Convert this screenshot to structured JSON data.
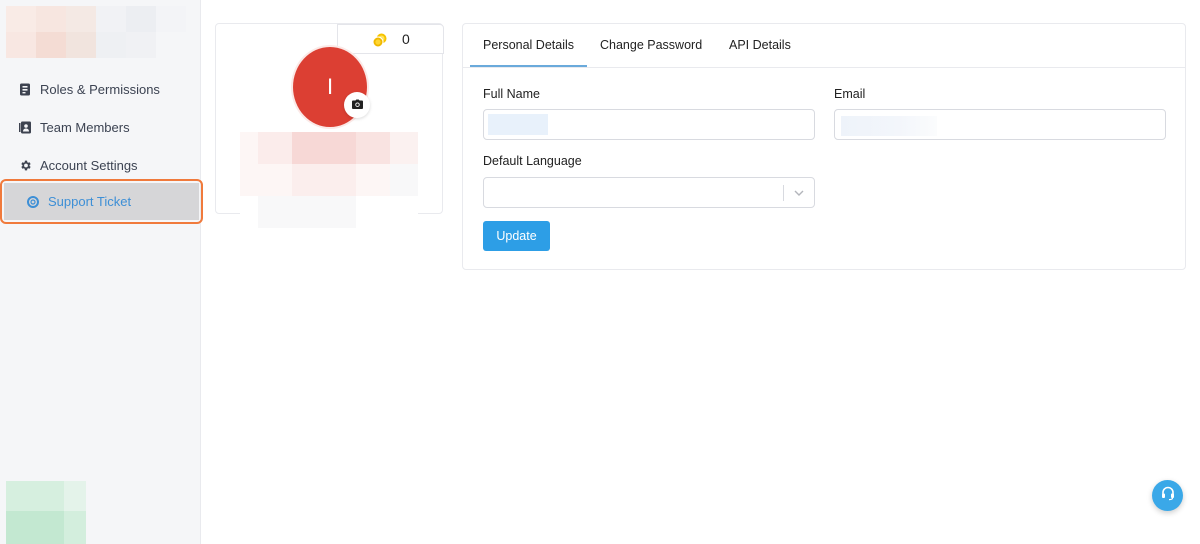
{
  "sidebar": {
    "items": [
      {
        "label": "Roles & Permissions",
        "icon": "id-badge-icon"
      },
      {
        "label": "Team Members",
        "icon": "address-book-icon"
      },
      {
        "label": "Account Settings",
        "icon": "gear-icon"
      },
      {
        "label": "Support Ticket",
        "icon": "lifebuoy-icon",
        "selected": true
      }
    ],
    "selected_color": "#3d8fd6",
    "highlight_border": "#f07a3c"
  },
  "profile": {
    "avatar_letter": "I",
    "avatar_color": "#dc3f33",
    "coins": "0",
    "coin_icon": "coins-icon",
    "camera_icon": "camera-icon"
  },
  "details": {
    "tabs": [
      {
        "label": "Personal Details",
        "active": true
      },
      {
        "label": "Change Password"
      },
      {
        "label": "API Details"
      }
    ],
    "fields": {
      "full_name_label": "Full Name",
      "email_label": "Email",
      "language_label": "Default Language"
    },
    "update_label": "Update",
    "accent": "#2d9ee6"
  },
  "help": {
    "icon": "headset-icon"
  }
}
